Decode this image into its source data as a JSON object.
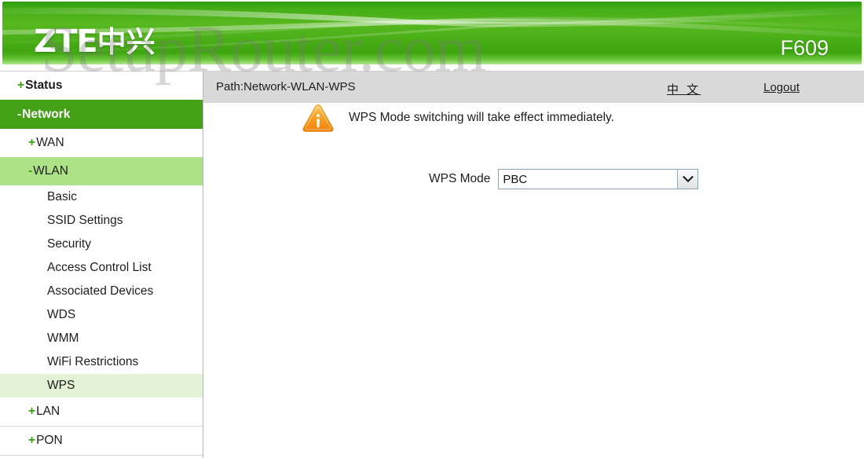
{
  "header": {
    "brand": "ZTE",
    "brand_cn": "中兴",
    "model": "F609",
    "watermark": "SetupRouter.com",
    "accent_green": "#44a017",
    "highlight_green": "#aee287",
    "selected_green": "#e3f2d4"
  },
  "sidebar": {
    "items": [
      {
        "label": "Status",
        "marker": "+",
        "level": 1,
        "state": "collapsed"
      },
      {
        "label": "Network",
        "marker": "-",
        "level": 1,
        "state": "active"
      },
      {
        "label": "WAN",
        "marker": "+",
        "level": 2,
        "state": "collapsed"
      },
      {
        "label": "WLAN",
        "marker": "-",
        "level": 2,
        "state": "open"
      },
      {
        "label": "Basic",
        "marker": "",
        "level": 3,
        "state": "normal"
      },
      {
        "label": "SSID Settings",
        "marker": "",
        "level": 3,
        "state": "normal"
      },
      {
        "label": "Security",
        "marker": "",
        "level": 3,
        "state": "normal"
      },
      {
        "label": "Access Control List",
        "marker": "",
        "level": 3,
        "state": "normal"
      },
      {
        "label": "Associated Devices",
        "marker": "",
        "level": 3,
        "state": "normal"
      },
      {
        "label": "WDS",
        "marker": "",
        "level": 3,
        "state": "normal"
      },
      {
        "label": "WMM",
        "marker": "",
        "level": 3,
        "state": "normal"
      },
      {
        "label": "WiFi Restrictions",
        "marker": "",
        "level": 3,
        "state": "normal"
      },
      {
        "label": "WPS",
        "marker": "",
        "level": 3,
        "state": "selected"
      },
      {
        "label": "LAN",
        "marker": "+",
        "level": 2,
        "state": "collapsed"
      },
      {
        "label": "PON",
        "marker": "+",
        "level": 2,
        "state": "collapsed"
      }
    ]
  },
  "topbar": {
    "path": "Path:Network-WLAN-WPS",
    "language_link": "中 文",
    "logout_link": "Logout"
  },
  "main": {
    "notice": "WPS Mode switching will take effect immediately.",
    "notice_icon": "warning-triangle-icon",
    "form": {
      "wps_mode_label": "WPS Mode",
      "wps_mode_value": "PBC"
    }
  }
}
